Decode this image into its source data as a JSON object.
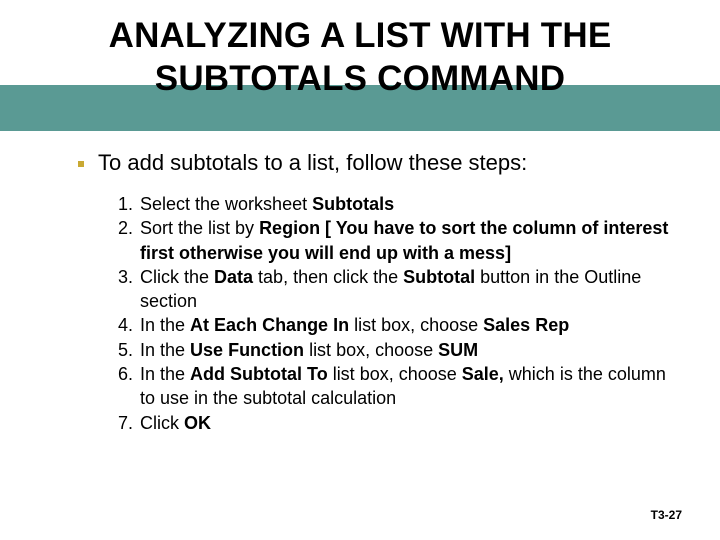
{
  "title_line1": "ANALYZING A LIST WITH THE",
  "title_line2": "SUBTOTALS COMMAND",
  "lead": "To add subtotals to a list, follow these steps:",
  "steps": [
    "Select the worksheet <b>Subtotals</b>",
    "Sort the list by <b>Region [ You have to sort the column of interest first otherwise you will end up with a mess]</b>",
    "Click the <b>Data</b> tab, then click the <b>Subtotal</b> button in the Outline section",
    "In the <b>At Each Change In</b> list box, choose <b>Sales Rep</b>",
    "In the <b>Use Function</b> list box, choose <b>SUM</b>",
    "In the <b>Add Subtotal To</b> list box, choose <b>Sale,</b> which is the column to use in the subtotal calculation",
    "Click <b>OK</b>"
  ],
  "footer": "T3-27"
}
